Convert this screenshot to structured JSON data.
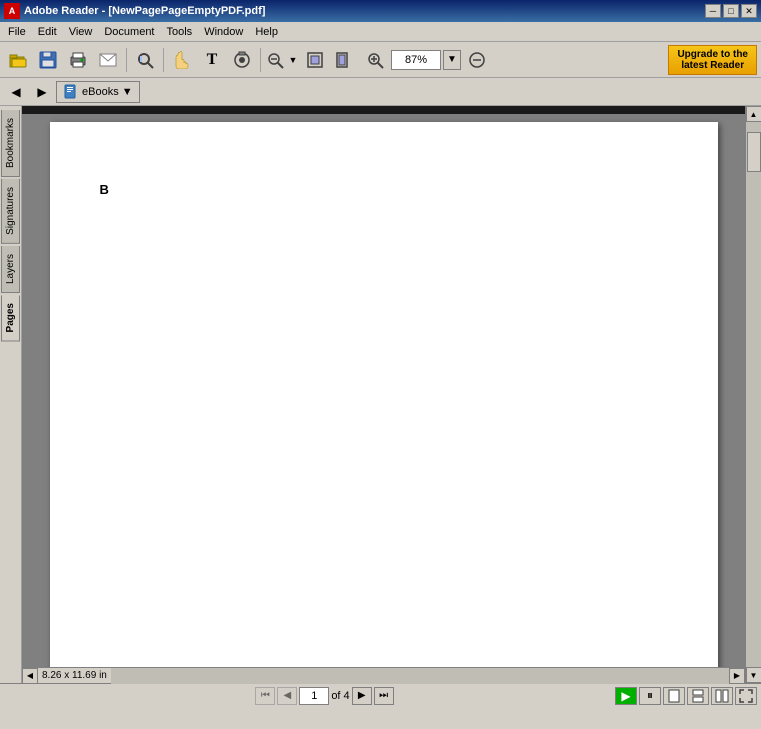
{
  "titlebar": {
    "title": "Adobe Reader - [NewPagePageEmptyPDF.pdf]",
    "icon_label": "A",
    "minimize": "─",
    "restore": "□",
    "close": "✕"
  },
  "menubar": {
    "items": [
      "File",
      "Edit",
      "View",
      "Document",
      "Tools",
      "Window",
      "Help"
    ]
  },
  "toolbar1": {
    "buttons": [
      {
        "name": "open",
        "icon": "📂"
      },
      {
        "name": "save",
        "icon": "💾"
      },
      {
        "name": "print",
        "icon": "🖨"
      },
      {
        "name": "email",
        "icon": "✉"
      },
      {
        "name": "search",
        "icon": "🔍"
      },
      {
        "name": "hand-tool",
        "icon": "✋"
      },
      {
        "name": "select-text",
        "icon": "T"
      },
      {
        "name": "snapshot",
        "icon": "◎"
      }
    ],
    "zoom_value": "87%",
    "zoom_in_icon": "+",
    "zoom_out_icon": "−",
    "zoom_fit_icon": "⊡",
    "upgrade_line1": "Upgrade to the",
    "upgrade_line2": "latest Reader"
  },
  "toolbar2": {
    "nav_back": "◀",
    "nav_forward": "▶",
    "ebooks_label": "eBooks",
    "ebooks_arrow": "▼"
  },
  "side_tabs": {
    "bookmarks": "Bookmarks",
    "signatures": "Signatures",
    "layers": "Layers",
    "pages": "Pages"
  },
  "pdf": {
    "content": "B",
    "page_width": "8.26 x 11.69 in"
  },
  "statusbar": {
    "page_current": "1",
    "page_of": "of 4",
    "size": "8.26 x 11.69 in"
  }
}
